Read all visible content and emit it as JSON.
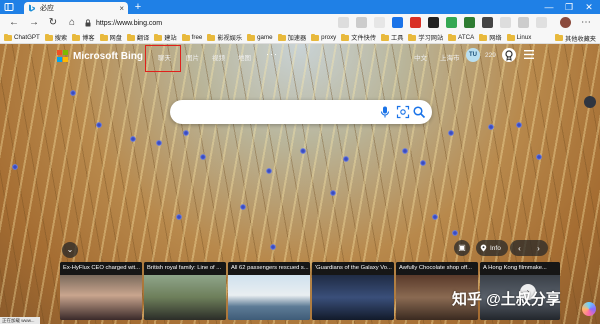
{
  "browser": {
    "tab_title": "必应",
    "new_tab": "+",
    "url": "https://www.bing.com",
    "window_controls": {
      "minimize": "—",
      "restore": "❐",
      "close": "✕"
    }
  },
  "bookmarks": {
    "items": [
      "ChatGPT",
      "搜索",
      "博客",
      "网盘",
      "翻译",
      "建站",
      "free",
      "影视娱乐",
      "game",
      "加速器",
      "proxy",
      "文件快传",
      "工具",
      "学习网站",
      "ATCA",
      "网络",
      "Linux"
    ],
    "right": "其他收藏夹"
  },
  "page": {
    "logo": "Microsoft Bing",
    "nav": [
      "聊天",
      "图片",
      "视频",
      "地图"
    ],
    "top_right": [
      "中文",
      "上海市"
    ],
    "avatar_initials": "TU",
    "reward_count": "229",
    "search_placeholder": "",
    "info_label": "Info",
    "prev": "‹",
    "next": "›",
    "news_prev": "‹",
    "news_next": "›"
  },
  "news": [
    {
      "title": "Ex-HyFlux CEO charged wit..."
    },
    {
      "title": "British royal family: Line of ..."
    },
    {
      "title": "All 62 passengers rescued s..."
    },
    {
      "title": "'Guardians of the Galaxy Vo..."
    },
    {
      "title": "Awfully Chocolate shop off..."
    },
    {
      "title": "A Hong Kong filmmake..."
    }
  ],
  "watermark": "知乎 @土叔分享",
  "status_text": "正在加载 www..."
}
